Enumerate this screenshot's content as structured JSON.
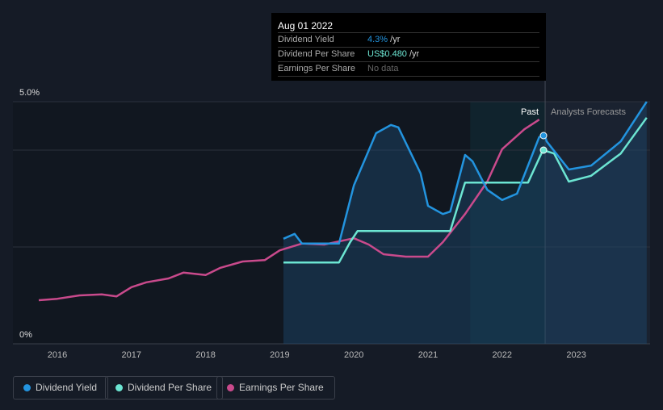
{
  "tooltip": {
    "date": "Aug 01 2022",
    "rows": [
      {
        "label": "Dividend Yield",
        "value": "4.3%",
        "unit": " /yr",
        "color": "#2394df"
      },
      {
        "label": "Dividend Per Share",
        "value": "US$0.480",
        "unit": " /yr",
        "color": "#6ce5d2"
      },
      {
        "label": "Earnings Per Share",
        "value": "No data",
        "unit": "",
        "color": "#666666"
      }
    ]
  },
  "chart_data": {
    "type": "line",
    "ylim": [
      0,
      5
    ],
    "xlim": [
      2015.6,
      2023.98
    ],
    "y_tick_labels": [
      "5.0%",
      "0%"
    ],
    "x_tick_labels": [
      "2016",
      "2017",
      "2018",
      "2019",
      "2020",
      "2021",
      "2022",
      "2023"
    ],
    "past_label": "Past",
    "forecast_label": "Analysts Forecasts",
    "forecast_start": 2022.58,
    "past_highlight_start": 2021.57,
    "series": [
      {
        "name": "Dividend Yield",
        "color": "#2394df",
        "x": [
          2019.05,
          2019.2,
          2019.3,
          2019.8,
          2020.0,
          2020.3,
          2020.5,
          2020.6,
          2020.9,
          2021.0,
          2021.2,
          2021.3,
          2021.5,
          2021.6,
          2021.8,
          2022.0,
          2022.2,
          2022.5,
          2022.58,
          2022.6,
          2022.9,
          2023.2,
          2023.6,
          2023.95
        ],
        "y": [
          2.17,
          2.27,
          2.07,
          2.07,
          3.27,
          4.35,
          4.52,
          4.47,
          3.52,
          2.85,
          2.68,
          2.73,
          3.9,
          3.77,
          3.18,
          2.97,
          3.1,
          4.27,
          4.3,
          4.18,
          3.6,
          3.68,
          4.18,
          5.0
        ]
      },
      {
        "name": "Dividend Per Share",
        "color": "#6ce5d2",
        "x": [
          2019.05,
          2019.8,
          2019.95,
          2020.05,
          2021.3,
          2021.5,
          2022.35,
          2022.55,
          2022.7,
          2022.9,
          2023.2,
          2023.6,
          2023.95
        ],
        "y": [
          1.68,
          1.68,
          2.1,
          2.33,
          2.33,
          3.33,
          3.33,
          4.0,
          3.93,
          3.35,
          3.47,
          3.93,
          4.67
        ]
      },
      {
        "name": "Earnings Per Share",
        "color": "#c94a8c",
        "x": [
          2015.75,
          2016.0,
          2016.3,
          2016.6,
          2016.8,
          2017.0,
          2017.2,
          2017.5,
          2017.7,
          2018.0,
          2018.2,
          2018.5,
          2018.8,
          2019.0,
          2019.3,
          2019.6,
          2020.0,
          2020.2,
          2020.4,
          2020.7,
          2021.0,
          2021.2,
          2021.5,
          2021.8,
          2022.0,
          2022.3,
          2022.5
        ],
        "y": [
          0.9,
          0.93,
          1.0,
          1.02,
          0.98,
          1.17,
          1.27,
          1.35,
          1.47,
          1.42,
          1.57,
          1.7,
          1.73,
          1.93,
          2.07,
          2.05,
          2.18,
          2.05,
          1.85,
          1.8,
          1.8,
          2.1,
          2.68,
          3.35,
          4.02,
          4.43,
          4.63
        ]
      }
    ]
  },
  "legend": [
    {
      "label": "Dividend Yield",
      "color": "#2394df"
    },
    {
      "label": "Dividend Per Share",
      "color": "#6ce5d2"
    },
    {
      "label": "Earnings Per Share",
      "color": "#c94a8c"
    }
  ]
}
